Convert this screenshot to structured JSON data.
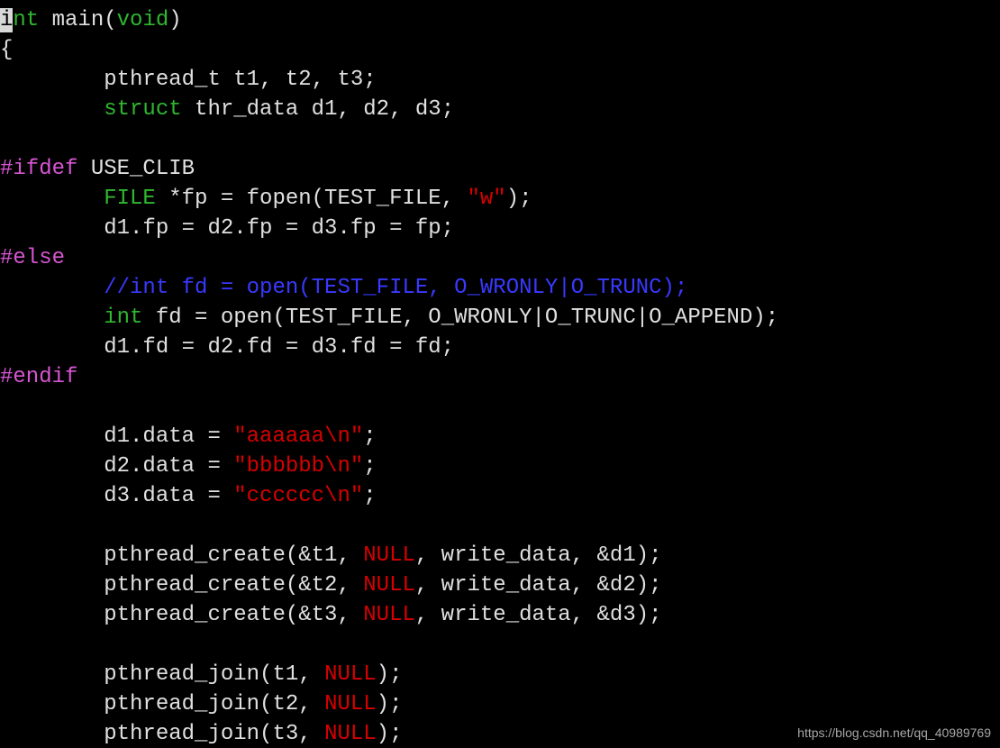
{
  "cursor_char": "i",
  "colors": {
    "background": "#000000",
    "cursor_bg": "#d8d8d8",
    "type": "#2fb72f",
    "preproc": "#d755d2",
    "comment": "#3939ff",
    "string": "#d70000",
    "null": "#d70000",
    "plain": "#e0e0e0",
    "watermark": "#a8a8a8"
  },
  "line1": {
    "t1": "i",
    "t2": "nt",
    "t3": " main(",
    "t4": "void",
    "t5": ")"
  },
  "line2": "{",
  "line3": "        pthread_t t1, t2, t3;",
  "line4": {
    "t1": "        ",
    "t2": "struct",
    "t3": " thr_data d1, d2, d3;"
  },
  "line5": "",
  "line6": {
    "t1": "#ifdef",
    "t2": " USE_CLIB"
  },
  "line7": {
    "t1": "        ",
    "t2": "FILE",
    "t3": " *fp = fopen(TEST_FILE, ",
    "t4": "\"w\"",
    "t5": ");"
  },
  "line8": "        d1.fp = d2.fp = d3.fp = fp;",
  "line9": "#else",
  "line10": {
    "t1": "        ",
    "t2": "//int fd = open(TEST_FILE, O_WRONLY|O_TRUNC);"
  },
  "line11": {
    "t1": "        ",
    "t2": "int",
    "t3": " fd = open(TEST_FILE, O_WRONLY|O_TRUNC|O_APPEND);"
  },
  "line12": "        d1.fd = d2.fd = d3.fd = fd;",
  "line13": "#endif",
  "line14": "",
  "line15": {
    "t1": "        d1.data = ",
    "t2": "\"aaaaaa\\n\"",
    "t3": ";"
  },
  "line16": {
    "t1": "        d2.data = ",
    "t2": "\"bbbbbb\\n\"",
    "t3": ";"
  },
  "line17": {
    "t1": "        d3.data = ",
    "t2": "\"cccccc\\n\"",
    "t3": ";"
  },
  "line18": "",
  "line19": {
    "t1": "        pthread_create(&t1, ",
    "t2": "NULL",
    "t3": ", write_data, &d1);"
  },
  "line20": {
    "t1": "        pthread_create(&t2, ",
    "t2": "NULL",
    "t3": ", write_data, &d2);"
  },
  "line21": {
    "t1": "        pthread_create(&t3, ",
    "t2": "NULL",
    "t3": ", write_data, &d3);"
  },
  "line22": "",
  "line23": {
    "t1": "        pthread_join(t1, ",
    "t2": "NULL",
    "t3": ");"
  },
  "line24": {
    "t1": "        pthread_join(t2, ",
    "t2": "NULL",
    "t3": ");"
  },
  "line25": {
    "t1": "        pthread_join(t3, ",
    "t2": "NULL",
    "t3": ");"
  },
  "watermark": "https://blog.csdn.net/qq_40989769"
}
